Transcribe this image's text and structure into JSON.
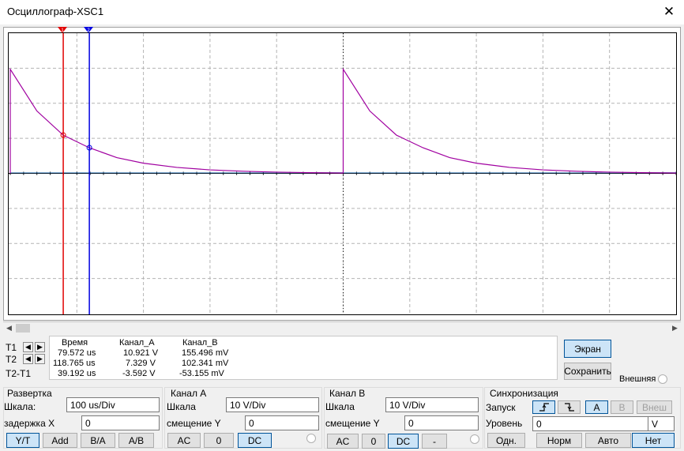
{
  "window": {
    "title": "Осциллограф-XSC1",
    "close": "✕"
  },
  "cursors": {
    "t1_marker": "1",
    "t2_marker": "2"
  },
  "readout": {
    "headers": [
      "Время",
      "Канал_A",
      "Канал_B"
    ],
    "rows": [
      {
        "label": "T1",
        "time": "79.572 us",
        "a": "10.921 V",
        "b": "155.496 mV"
      },
      {
        "label": "T2",
        "time": "118.765 us",
        "a": "7.329 V",
        "b": "102.341 mV"
      },
      {
        "label": "T2-T1",
        "time": "39.192 us",
        "a": "-3.592 V",
        "b": "-53.155 mV"
      }
    ],
    "arrow_left": "◀",
    "arrow_right": "▶"
  },
  "side": {
    "screen_button": "Экран",
    "save_button": "Сохранить",
    "ext_label": "Внешняя"
  },
  "sweep": {
    "title": "Развертка",
    "scale_label": "Шкала:",
    "scale_value": "100 us/Div",
    "delay_label": "задержка X",
    "delay_value": "0",
    "buttons": [
      "Y/T",
      "Add",
      "B/A",
      "A/B"
    ]
  },
  "channel_a": {
    "title": "Канал A",
    "scale_label": "Шкала",
    "scale_value": "10  V/Div",
    "offset_label": "смещение Y",
    "offset_value": "0",
    "buttons": [
      "AC",
      "0",
      "DC"
    ]
  },
  "channel_b": {
    "title": "Канал B",
    "scale_label": "Шкала",
    "scale_value": "10  V/Div",
    "offset_label": "смещение Y",
    "offset_value": "0",
    "buttons": [
      "AC",
      "0",
      "DC",
      "-"
    ]
  },
  "trigger": {
    "title": "Синхронизация",
    "start_label": "Запуск",
    "source_buttons": [
      "A",
      "B",
      "Внеш"
    ],
    "level_label": "Уровень",
    "level_value": "0",
    "level_unit": "V",
    "mode_buttons": [
      "Одн.",
      "Норм",
      "Авто",
      "Нет"
    ]
  },
  "colors": {
    "trace_a": "#a000a0",
    "cursor_1": "#e00000",
    "cursor_2": "#0000e0",
    "grid": "#b4b4b4",
    "selected": "#cce4f7"
  },
  "chart_data": {
    "type": "line",
    "x_unit": "us",
    "xlim": [
      0,
      1000
    ],
    "ylim": [
      -40,
      40
    ],
    "series": [
      {
        "name": "Канал_A",
        "x": [
          0,
          40,
          79.6,
          118.8,
          160,
          200,
          250,
          300,
          350,
          400,
          450,
          499,
          500,
          540,
          580,
          620,
          660,
          700,
          750,
          800,
          850,
          900,
          950,
          1000
        ],
        "y": [
          29.7,
          17.8,
          10.9,
          7.3,
          4.5,
          2.9,
          1.7,
          1.0,
          0.6,
          0.35,
          0.2,
          0.1,
          29.7,
          17.8,
          10.9,
          7.3,
          4.5,
          2.9,
          1.7,
          1.0,
          0.6,
          0.35,
          0.2,
          0.1
        ]
      },
      {
        "name": "Канал_B",
        "x": [
          0,
          1000
        ],
        "y": [
          0.16,
          0.16
        ]
      }
    ],
    "cursors": {
      "T1": 79.572,
      "T2": 118.765
    }
  }
}
